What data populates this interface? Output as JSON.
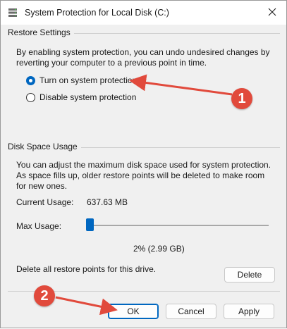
{
  "window": {
    "title": "System Protection for Local Disk (C:)"
  },
  "restore_settings": {
    "group_label": "Restore Settings",
    "description": "By enabling system protection, you can undo undesired changes by reverting your computer to a previous point in time.",
    "options": [
      {
        "label": "Turn on system protection",
        "selected": true
      },
      {
        "label": "Disable system protection",
        "selected": false
      }
    ]
  },
  "disk_space": {
    "group_label": "Disk Space Usage",
    "description": "You can adjust the maximum disk space used for system protection. As space fills up, older restore points will be deleted to make room for new ones.",
    "current_usage_label": "Current Usage:",
    "current_usage_value": "637.63 MB",
    "max_usage_label": "Max Usage:",
    "max_usage_value": "2% (2.99 GB)",
    "max_usage_percent": 2,
    "delete_text": "Delete all restore points for this drive.",
    "delete_button": "Delete"
  },
  "footer": {
    "ok": "OK",
    "cancel": "Cancel",
    "apply": "Apply"
  },
  "annotations": [
    {
      "number": "1"
    },
    {
      "number": "2"
    }
  ],
  "colors": {
    "accent": "#0067c0",
    "annotation": "#e14a3c"
  }
}
